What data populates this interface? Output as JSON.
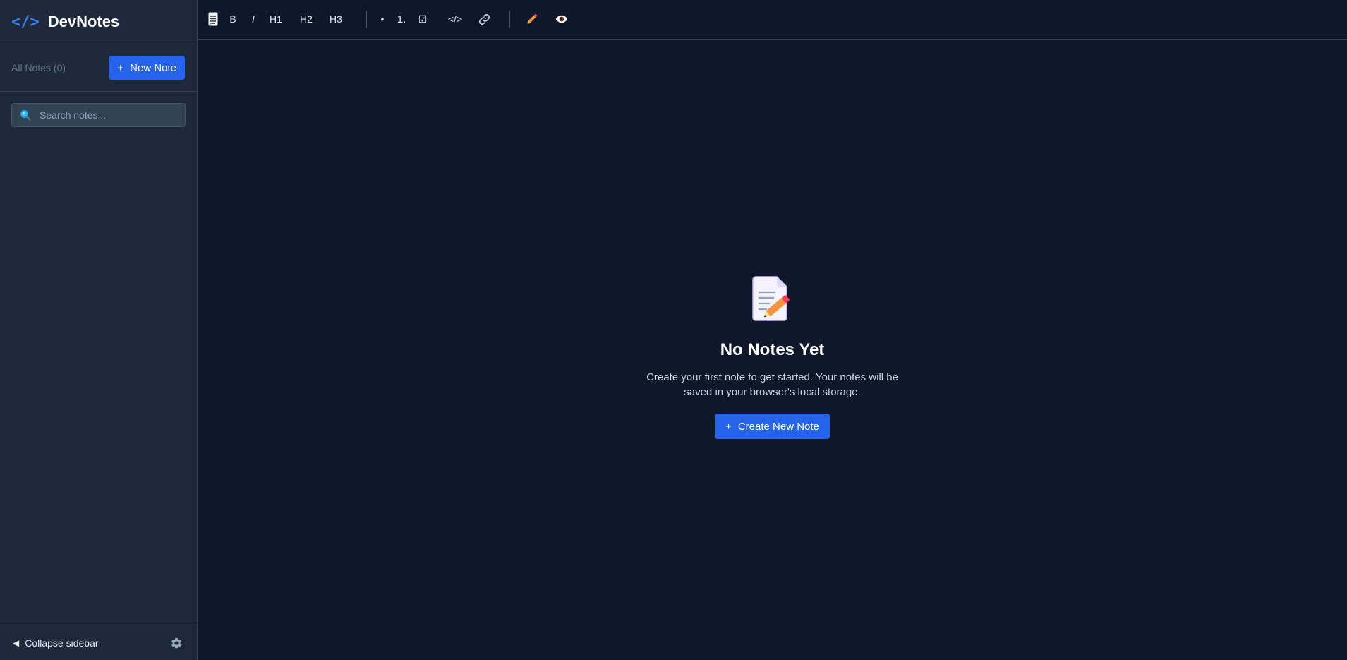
{
  "brand": {
    "logo": "</>",
    "title": "DevNotes"
  },
  "sidebar": {
    "notes_count_label": "All Notes (0)",
    "new_note_label": "New Note",
    "search": {
      "placeholder": "Search notes...",
      "value": ""
    },
    "footer": {
      "collapse_label": "Collapse sidebar"
    }
  },
  "toolbar": {
    "bold": "B",
    "italic": "I",
    "h1": "H1",
    "h2": "H2",
    "h3": "H3",
    "bullet": "•",
    "numbered": "1.",
    "checklist": "☑",
    "code": "</>"
  },
  "empty_state": {
    "title": "No Notes Yet",
    "description": "Create your first note to get started. Your notes will be saved in your browser's local storage.",
    "button_label": "Create New Note"
  },
  "icons": {
    "document": "document-icon",
    "link": "link-icon",
    "edit": "pencil-icon",
    "preview": "eye-icon",
    "search": "magnifier-icon",
    "settings": "gear-icon",
    "empty": "memo-icon"
  },
  "colors": {
    "background": "#0f172a",
    "sidebar": "#1e293b",
    "accent": "#2563eb",
    "border": "#334155"
  }
}
